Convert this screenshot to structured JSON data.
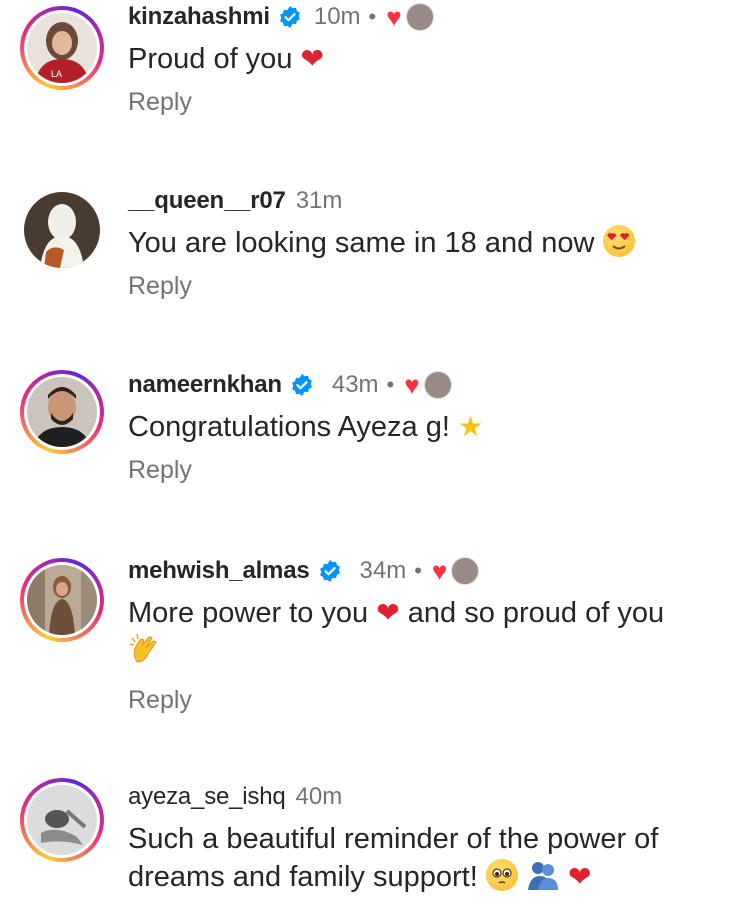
{
  "comments": [
    {
      "username": "kinzahashmi",
      "verified": true,
      "time": "10m",
      "liked_by_author": true,
      "text": "Proud of you",
      "emoji_after": "heart",
      "reply": "Reply"
    },
    {
      "username": "__queen__r07",
      "verified": false,
      "time": "31m",
      "liked_by_author": false,
      "text": "You are looking same in 18 and now",
      "emoji_after": "heart-eyes",
      "reply": "Reply"
    },
    {
      "username": "nameernkhan",
      "verified": true,
      "time": "43m",
      "liked_by_author": true,
      "text": "Congratulations Ayeza g!",
      "emoji_after": "star",
      "reply": "Reply"
    },
    {
      "username": "mehwish_almas",
      "verified": true,
      "time": "34m",
      "liked_by_author": true,
      "text_part1": "More power to you",
      "text_part2": "and so proud of you",
      "emoji_middle": "heart",
      "emoji_after": "clapping-hands",
      "reply": "Reply"
    },
    {
      "username": "ayeza_se_ishq",
      "verified": false,
      "time": "40m",
      "liked_by_author": false,
      "text": "Such a beautiful reminder of the power of dreams and family support!",
      "emoji_after": "pleading-face, people-hugging, heart"
    }
  ],
  "colors": {
    "text": "#262626",
    "muted": "#737373",
    "verified": "#0095f6",
    "like": "#ff3040"
  },
  "glyphs": {
    "dot": "•",
    "heart": "♥",
    "red_heart": "❤",
    "star": "★"
  }
}
